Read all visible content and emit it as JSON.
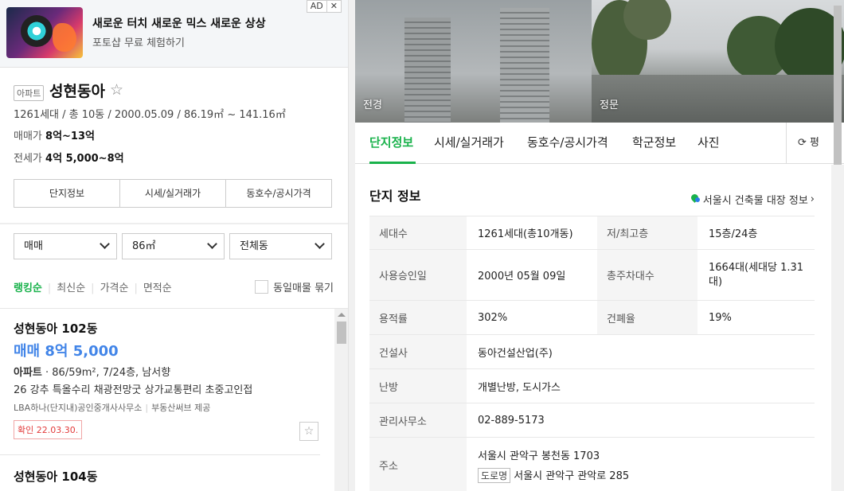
{
  "ad": {
    "title": "새로운 터치 새로운 믹스 새로운 상상",
    "subtitle": "포토샵 무료 체험하기",
    "badge": "AD",
    "close": "✕"
  },
  "property": {
    "type": "아파트",
    "name": "성현동아",
    "star": "☆",
    "summary": "1261세대 / 총 10동 / 2000.05.09 / 86.19㎡ ~ 141.16㎡",
    "sale_label": "매매가",
    "sale_value": "8억~13억",
    "jeonse_label": "전세가",
    "jeonse_value": "4억 5,000~8억",
    "tabs": [
      "단지정보",
      "시세/실거래가",
      "동호수/공시가격"
    ]
  },
  "filters": {
    "trade": "매매",
    "area": "86㎡",
    "dong": "전체동"
  },
  "sort": {
    "items": [
      "랭킹순",
      "최신순",
      "가격순",
      "면적순"
    ],
    "active": "랭킹순",
    "same_listing": "동일매물 묶기"
  },
  "listings": [
    {
      "title": "성현동아 102동",
      "price": "매매 8억 5,000",
      "kind": "아파트",
      "spec": " · 86/59m², 7/24층, 남서향",
      "desc": "26 강추 특올수리 채광전망굿 상가교통편리 초중고인접",
      "agent": "LBA하나(단지내)공인중개사사무소",
      "provider": "부동산써브 제공",
      "confirmed": "확인 22.03.30."
    },
    {
      "title": "성현동아 104동"
    }
  ],
  "photos": [
    {
      "label": "전경"
    },
    {
      "label": "정문"
    }
  ],
  "right_tabs": {
    "items": [
      "단지정보",
      "시세/실거래가",
      "동호수/공시가격",
      "학군정보",
      "사진"
    ],
    "active": "단지정보",
    "pyeong_button": "평"
  },
  "complex": {
    "title": "단지 정보",
    "registry_link": "서울시 건축물 대장 정보",
    "rows": [
      {
        "k1": "세대수",
        "v1": "1261세대(총10개동)",
        "k2": "저/최고층",
        "v2": "15층/24층"
      },
      {
        "k1": "사용승인일",
        "v1": "2000년 05월 09일",
        "k2": "총주차대수",
        "v2": "1664대(세대당 1.31대)"
      },
      {
        "k1": "용적률",
        "v1": "302%",
        "k2": "건폐율",
        "v2": "19%"
      },
      {
        "k1": "건설사",
        "v1": "동아건설산업(주)"
      },
      {
        "k1": "난방",
        "v1": "개별난방, 도시가스"
      },
      {
        "k1": "관리사무소",
        "v1": "02-889-5173"
      },
      {
        "k1": "주소",
        "v1": "서울시 관악구 봉천동 1703",
        "road_tag": "도로명",
        "v1b": "서울시 관악구 관악로 285"
      }
    ]
  }
}
